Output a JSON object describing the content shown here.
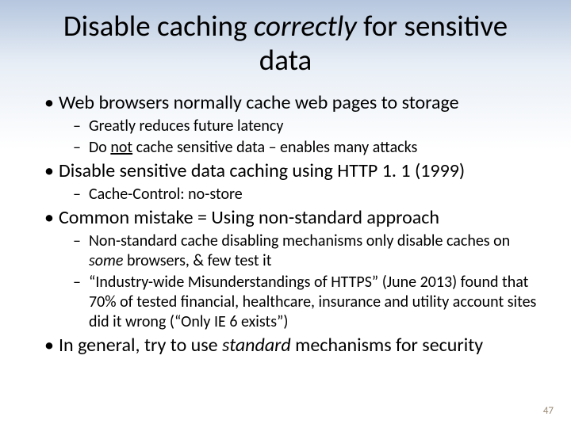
{
  "title": {
    "pre": "Disable caching ",
    "italic": "correctly",
    "post": " for sensitive data"
  },
  "items": {
    "b1": "Web browsers normally cache web pages to storage",
    "b1a": "Greatly reduces future latency",
    "b1b_pre": "Do ",
    "b1b_under": "not",
    "b1b_post": " cache sensitive data – enables many attacks",
    "b2": "Disable sensitive data caching using HTTP 1. 1 (1999)",
    "b2a": "Cache-Control: no-store",
    "b3": "Common mistake = Using non-standard approach",
    "b3a_pre": "Non-standard cache disabling mechanisms only disable caches on ",
    "b3a_ital": "some",
    "b3a_post": " browsers, & few test it",
    "b3b": "“Industry-wide Misunderstandings of HTTPS” (June 2013) found that  70% of tested financial, healthcare, insurance and utility account sites did it wrong (“Only IE 6 exists”)",
    "b4_pre": "In general, try to use ",
    "b4_ital": "standard",
    "b4_post": " mechanisms for security"
  },
  "page_number": "47"
}
